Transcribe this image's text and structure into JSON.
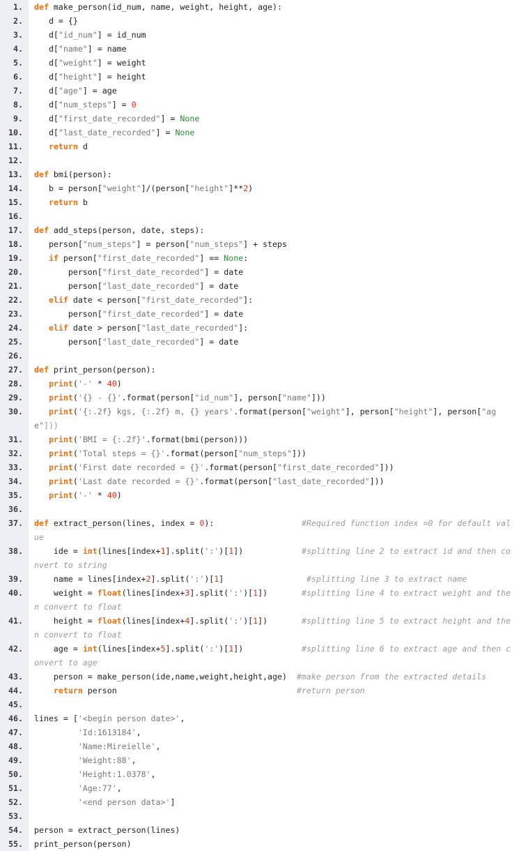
{
  "editor": {
    "lines": [
      {
        "n": "1.",
        "tokens": [
          [
            "kw",
            "def"
          ],
          [
            "t",
            " make_person(id_num, name, weight, height, age):"
          ]
        ]
      },
      {
        "n": "2.",
        "tokens": [
          [
            "t",
            "   d = {}"
          ]
        ]
      },
      {
        "n": "3.",
        "tokens": [
          [
            "t",
            "   d["
          ],
          [
            "str",
            "\"id_num\""
          ],
          [
            "t",
            "] = id_num"
          ]
        ]
      },
      {
        "n": "4.",
        "tokens": [
          [
            "t",
            "   d["
          ],
          [
            "str",
            "\"name\""
          ],
          [
            "t",
            "] = name"
          ]
        ]
      },
      {
        "n": "5.",
        "tokens": [
          [
            "t",
            "   d["
          ],
          [
            "str",
            "\"weight\""
          ],
          [
            "t",
            "] = weight"
          ]
        ]
      },
      {
        "n": "6.",
        "tokens": [
          [
            "t",
            "   d["
          ],
          [
            "str",
            "\"height\""
          ],
          [
            "t",
            "] = height"
          ]
        ]
      },
      {
        "n": "7.",
        "tokens": [
          [
            "t",
            "   d["
          ],
          [
            "str",
            "\"age\""
          ],
          [
            "t",
            "] = age"
          ]
        ]
      },
      {
        "n": "8.",
        "tokens": [
          [
            "t",
            "   d["
          ],
          [
            "str",
            "\"num_steps\""
          ],
          [
            "t",
            "] = "
          ],
          [
            "number",
            "0"
          ]
        ]
      },
      {
        "n": "9.",
        "tokens": [
          [
            "t",
            "   d["
          ],
          [
            "str",
            "\"first_date_recorded\""
          ],
          [
            "t",
            "] = "
          ],
          [
            "none",
            "None"
          ]
        ]
      },
      {
        "n": "10.",
        "tokens": [
          [
            "t",
            "   d["
          ],
          [
            "str",
            "\"last_date_recorded\""
          ],
          [
            "t",
            "] = "
          ],
          [
            "none",
            "None"
          ]
        ]
      },
      {
        "n": "11.",
        "tokens": [
          [
            "t",
            "   "
          ],
          [
            "kw",
            "return"
          ],
          [
            "t",
            " d"
          ]
        ]
      },
      {
        "n": "12.",
        "tokens": []
      },
      {
        "n": "13.",
        "tokens": [
          [
            "kw",
            "def"
          ],
          [
            "t",
            " bmi(person):"
          ]
        ]
      },
      {
        "n": "14.",
        "tokens": [
          [
            "t",
            "   b = person["
          ],
          [
            "str",
            "\"weight\""
          ],
          [
            "t",
            "]/(person["
          ],
          [
            "str",
            "\"height\""
          ],
          [
            "t",
            "]**"
          ],
          [
            "number",
            "2"
          ],
          [
            "t",
            ")"
          ]
        ]
      },
      {
        "n": "15.",
        "tokens": [
          [
            "t",
            "   "
          ],
          [
            "kw",
            "return"
          ],
          [
            "t",
            " b"
          ]
        ]
      },
      {
        "n": "16.",
        "tokens": []
      },
      {
        "n": "17.",
        "tokens": [
          [
            "kw",
            "def"
          ],
          [
            "t",
            " add_steps(person, date, steps):"
          ]
        ]
      },
      {
        "n": "18.",
        "tokens": [
          [
            "t",
            "   person["
          ],
          [
            "str",
            "\"num_steps\""
          ],
          [
            "t",
            "] = person["
          ],
          [
            "str",
            "\"num_steps\""
          ],
          [
            "t",
            "] + steps"
          ]
        ]
      },
      {
        "n": "19.",
        "tokens": [
          [
            "t",
            "   "
          ],
          [
            "kw",
            "if"
          ],
          [
            "t",
            " person["
          ],
          [
            "str",
            "\"first_date_recorded\""
          ],
          [
            "t",
            "] == "
          ],
          [
            "none",
            "None"
          ],
          [
            "t",
            ":"
          ]
        ]
      },
      {
        "n": "20.",
        "tokens": [
          [
            "t",
            "       person["
          ],
          [
            "str",
            "\"first_date_recorded\""
          ],
          [
            "t",
            "] = date"
          ]
        ]
      },
      {
        "n": "21.",
        "tokens": [
          [
            "t",
            "       person["
          ],
          [
            "str",
            "\"last_date_recorded\""
          ],
          [
            "t",
            "] = date"
          ]
        ]
      },
      {
        "n": "22.",
        "tokens": [
          [
            "t",
            "   "
          ],
          [
            "kw",
            "elif"
          ],
          [
            "t",
            " date < person["
          ],
          [
            "str",
            "\"first_date_recorded\""
          ],
          [
            "t",
            "]:"
          ]
        ]
      },
      {
        "n": "23.",
        "tokens": [
          [
            "t",
            "       person["
          ],
          [
            "str",
            "\"first_date_recorded\""
          ],
          [
            "t",
            "] = date"
          ]
        ]
      },
      {
        "n": "24.",
        "tokens": [
          [
            "t",
            "   "
          ],
          [
            "kw",
            "elif"
          ],
          [
            "t",
            " date > person["
          ],
          [
            "str",
            "\"last_date_recorded\""
          ],
          [
            "t",
            "]:"
          ]
        ]
      },
      {
        "n": "25.",
        "tokens": [
          [
            "t",
            "       person["
          ],
          [
            "str",
            "\"last_date_recorded\""
          ],
          [
            "t",
            "] = date"
          ]
        ]
      },
      {
        "n": "26.",
        "tokens": []
      },
      {
        "n": "27.",
        "tokens": [
          [
            "kw",
            "def"
          ],
          [
            "t",
            " print_person(person):"
          ]
        ]
      },
      {
        "n": "28.",
        "tokens": [
          [
            "t",
            "   "
          ],
          [
            "kw",
            "print"
          ],
          [
            "t",
            "("
          ],
          [
            "str",
            "'-'"
          ],
          [
            "t",
            " * "
          ],
          [
            "number",
            "40"
          ],
          [
            "t",
            ")"
          ]
        ]
      },
      {
        "n": "29.",
        "tokens": [
          [
            "t",
            "   "
          ],
          [
            "kw",
            "print"
          ],
          [
            "t",
            "("
          ],
          [
            "str",
            "'{} - {}'"
          ],
          [
            "t",
            ".format(person["
          ],
          [
            "str",
            "\"id_num\""
          ],
          [
            "t",
            "], person["
          ],
          [
            "str",
            "\"name\""
          ],
          [
            "t",
            "]))"
          ]
        ]
      },
      {
        "n": "30.",
        "tokens": [
          [
            "t",
            "   "
          ],
          [
            "kw",
            "print"
          ],
          [
            "t",
            "("
          ],
          [
            "str",
            "'{:.2f} kgs, {:.2f} m, {} years'"
          ],
          [
            "t",
            ".format(person["
          ],
          [
            "str",
            "\"weight\""
          ],
          [
            "t",
            "], person["
          ],
          [
            "str",
            "\"height\""
          ],
          [
            "t",
            "], person["
          ],
          [
            "str",
            "\"ag"
          ]
        ],
        "wrap": [
          [
            "str",
            "e\""
          ],
          [
            "t",
            "]))"
          ]
        ]
      },
      {
        "n": "31.",
        "tokens": [
          [
            "t",
            "   "
          ],
          [
            "kw",
            "print"
          ],
          [
            "t",
            "("
          ],
          [
            "str",
            "'BMI = {:.2f}'"
          ],
          [
            "t",
            ".format(bmi(person)))"
          ]
        ]
      },
      {
        "n": "32.",
        "tokens": [
          [
            "t",
            "   "
          ],
          [
            "kw",
            "print"
          ],
          [
            "t",
            "("
          ],
          [
            "str",
            "'Total steps = {}'"
          ],
          [
            "t",
            ".format(person["
          ],
          [
            "str",
            "\"num_steps\""
          ],
          [
            "t",
            "]))"
          ]
        ]
      },
      {
        "n": "33.",
        "tokens": [
          [
            "t",
            "   "
          ],
          [
            "kw",
            "print"
          ],
          [
            "t",
            "("
          ],
          [
            "str",
            "'First date recorded = {}'"
          ],
          [
            "t",
            ".format(person["
          ],
          [
            "str",
            "\"first_date_recorded\""
          ],
          [
            "t",
            "]))"
          ]
        ]
      },
      {
        "n": "34.",
        "tokens": [
          [
            "t",
            "   "
          ],
          [
            "kw",
            "print"
          ],
          [
            "t",
            "("
          ],
          [
            "str",
            "'Last date recorded = {}'"
          ],
          [
            "t",
            ".format(person["
          ],
          [
            "str",
            "\"last_date_recorded\""
          ],
          [
            "t",
            "]))"
          ]
        ]
      },
      {
        "n": "35.",
        "tokens": [
          [
            "t",
            "   "
          ],
          [
            "kw",
            "print"
          ],
          [
            "t",
            "("
          ],
          [
            "str",
            "'-'"
          ],
          [
            "t",
            " * "
          ],
          [
            "number",
            "40"
          ],
          [
            "t",
            ")"
          ]
        ]
      },
      {
        "n": "36.",
        "tokens": []
      },
      {
        "n": "37.",
        "tokens": [
          [
            "kw",
            "def"
          ],
          [
            "t",
            " extract_person(lines, index = "
          ],
          [
            "number",
            "0"
          ],
          [
            "t",
            "):                  "
          ],
          [
            "cmt",
            "#Required function index =0 for default val"
          ]
        ],
        "wrap": [
          [
            "cmt",
            "ue"
          ]
        ]
      },
      {
        "n": "38.",
        "tokens": [
          [
            "t",
            "    ide = "
          ],
          [
            "kw",
            "int"
          ],
          [
            "t",
            "(lines[index+"
          ],
          [
            "number",
            "1"
          ],
          [
            "t",
            "].split("
          ],
          [
            "str",
            "':'"
          ],
          [
            "t",
            ")["
          ],
          [
            "number",
            "1"
          ],
          [
            "t",
            "])            "
          ],
          [
            "cmt",
            "#splitting line 2 to extract id and then co"
          ]
        ],
        "wrap": [
          [
            "cmt",
            "nvert to string"
          ]
        ]
      },
      {
        "n": "39.",
        "tokens": [
          [
            "t",
            "    name = lines[index+"
          ],
          [
            "number",
            "2"
          ],
          [
            "t",
            "].split("
          ],
          [
            "str",
            "':'"
          ],
          [
            "t",
            ")["
          ],
          [
            "number",
            "1"
          ],
          [
            "t",
            "]                 "
          ],
          [
            "cmt",
            "#splitting line 3 to extract name"
          ]
        ]
      },
      {
        "n": "40.",
        "tokens": [
          [
            "t",
            "    weight = "
          ],
          [
            "kw",
            "float"
          ],
          [
            "t",
            "(lines[index+"
          ],
          [
            "number",
            "3"
          ],
          [
            "t",
            "].split("
          ],
          [
            "str",
            "':'"
          ],
          [
            "t",
            ")["
          ],
          [
            "number",
            "1"
          ],
          [
            "t",
            "])       "
          ],
          [
            "cmt",
            "#splitting line 4 to extract weight and the"
          ]
        ],
        "wrap": [
          [
            "cmt",
            "n convert to float"
          ]
        ]
      },
      {
        "n": "41.",
        "tokens": [
          [
            "t",
            "    height = "
          ],
          [
            "kw",
            "float"
          ],
          [
            "t",
            "(lines[index+"
          ],
          [
            "number",
            "4"
          ],
          [
            "t",
            "].split("
          ],
          [
            "str",
            "':'"
          ],
          [
            "t",
            ")["
          ],
          [
            "number",
            "1"
          ],
          [
            "t",
            "])       "
          ],
          [
            "cmt",
            "#splitting line 5 to extract height and the"
          ]
        ],
        "wrap": [
          [
            "cmt",
            "n convert to float"
          ]
        ]
      },
      {
        "n": "42.",
        "tokens": [
          [
            "t",
            "    age = "
          ],
          [
            "kw",
            "int"
          ],
          [
            "t",
            "(lines[index+"
          ],
          [
            "number",
            "5"
          ],
          [
            "t",
            "].split("
          ],
          [
            "str",
            "':'"
          ],
          [
            "t",
            ")["
          ],
          [
            "number",
            "1"
          ],
          [
            "t",
            "])            "
          ],
          [
            "cmt",
            "#splitting line 6 to extract age and then c"
          ]
        ],
        "wrap": [
          [
            "cmt",
            "onvert to age"
          ]
        ]
      },
      {
        "n": "43.",
        "tokens": [
          [
            "t",
            "    person = make_person(ide,name,weight,height,age)  "
          ],
          [
            "cmt",
            "#make person from the extracted details"
          ]
        ]
      },
      {
        "n": "44.",
        "tokens": [
          [
            "t",
            "    "
          ],
          [
            "kw",
            "return"
          ],
          [
            "t",
            " person                                     "
          ],
          [
            "cmt",
            "#return person"
          ]
        ]
      },
      {
        "n": "45.",
        "tokens": []
      },
      {
        "n": "46.",
        "tokens": [
          [
            "t",
            "lines = ["
          ],
          [
            "str",
            "'<begin person date>'"
          ],
          [
            "t",
            ","
          ]
        ]
      },
      {
        "n": "47.",
        "tokens": [
          [
            "t",
            "         "
          ],
          [
            "str",
            "'Id:1613184'"
          ],
          [
            "t",
            ","
          ]
        ]
      },
      {
        "n": "48.",
        "tokens": [
          [
            "t",
            "         "
          ],
          [
            "str",
            "'Name:Mireielle'"
          ],
          [
            "t",
            ","
          ]
        ]
      },
      {
        "n": "49.",
        "tokens": [
          [
            "t",
            "         "
          ],
          [
            "str",
            "'Weight:88'"
          ],
          [
            "t",
            ","
          ]
        ]
      },
      {
        "n": "50.",
        "tokens": [
          [
            "t",
            "         "
          ],
          [
            "str",
            "'Height:1.0378'"
          ],
          [
            "t",
            ","
          ]
        ]
      },
      {
        "n": "51.",
        "tokens": [
          [
            "t",
            "         "
          ],
          [
            "str",
            "'Age:77'"
          ],
          [
            "t",
            ","
          ]
        ]
      },
      {
        "n": "52.",
        "tokens": [
          [
            "t",
            "         "
          ],
          [
            "str",
            "'<end person data>'"
          ],
          [
            "t",
            "]"
          ]
        ]
      },
      {
        "n": "53.",
        "tokens": []
      },
      {
        "n": "54.",
        "tokens": [
          [
            "t",
            "person = extract_person(lines)"
          ]
        ]
      },
      {
        "n": "55.",
        "tokens": [
          [
            "t",
            "print_person(person)"
          ]
        ]
      }
    ]
  }
}
